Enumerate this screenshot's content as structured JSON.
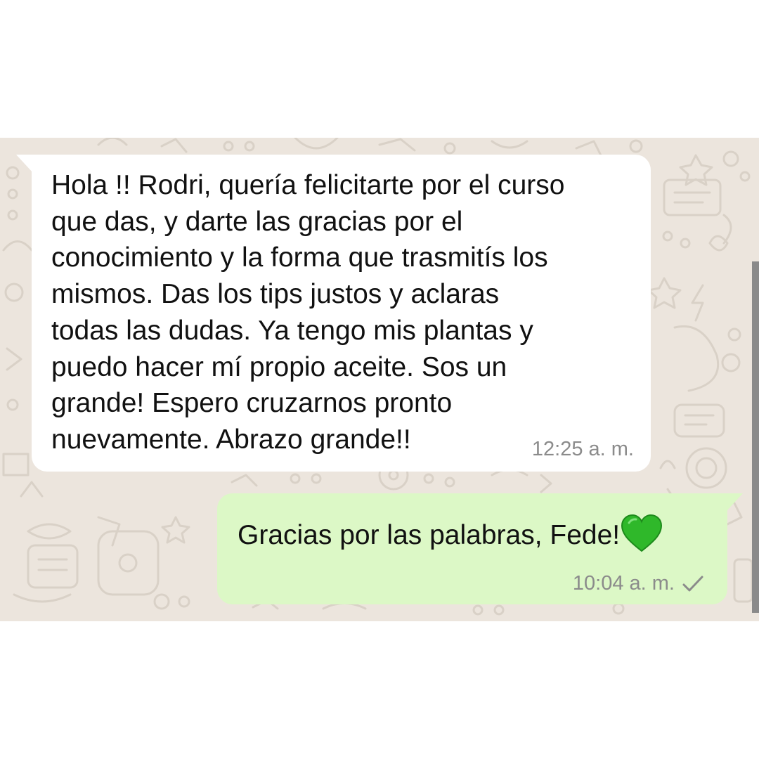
{
  "conversation": {
    "messages": [
      {
        "direction": "incoming",
        "text": "Hola !! Rodri, quería felicitarte por el curso\nque das, y darte las gracias por el\nconocimiento y la forma que trasmitís los\nmismos.  Das los tips justos y aclaras\ntodas las dudas. Ya tengo mis plantas y\npuedo hacer mí propio aceite. Sos un\ngrande! Espero cruzarnos pronto\nnuevamente. Abrazo grande!!",
        "time": "12:25 a. m."
      },
      {
        "direction": "outgoing",
        "text": "Gracias por las palabras, Fede!",
        "emoji": "green-heart-icon",
        "time": "10:04 a. m.",
        "status": "check-icon"
      }
    ]
  },
  "colors": {
    "wallpaper": "#ece5dd",
    "incoming_bubble": "#ffffff",
    "outgoing_bubble": "#dcf8c6",
    "heart": "#2fb82a",
    "meta_text": "#8b8b8b"
  }
}
